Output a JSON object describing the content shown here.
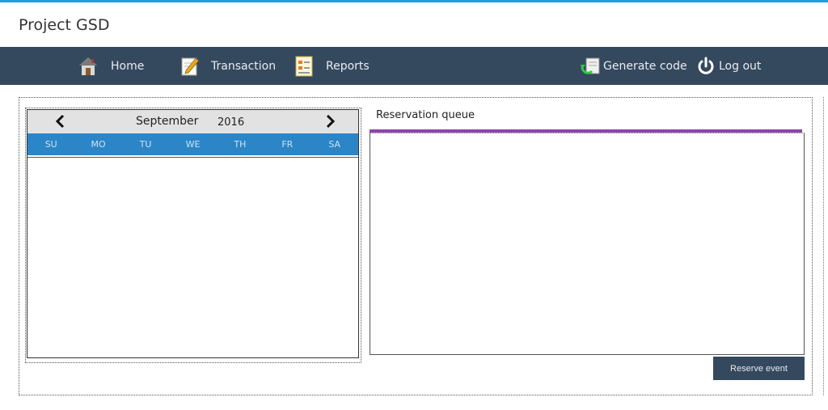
{
  "app": {
    "title": "Project GSD",
    "accent_color": "#1ba1e2"
  },
  "navbar": {
    "background": "#34495e",
    "items": [
      {
        "label": "Home",
        "icon": "house-icon"
      },
      {
        "label": "Transaction",
        "icon": "pencil-paper-icon"
      },
      {
        "label": "Reports",
        "icon": "report-document-icon"
      },
      {
        "label": "Generate code",
        "icon": "refresh-document-icon"
      },
      {
        "label": "Log out",
        "icon": "power-icon"
      }
    ]
  },
  "calendar": {
    "month": "September",
    "year": "2016",
    "prev_icon": "chevron-left-icon",
    "next_icon": "chevron-right-icon",
    "weekdays": [
      "SU",
      "MO",
      "TU",
      "WE",
      "TH",
      "FR",
      "SA"
    ],
    "weekday_bar_color": "#2b85c7"
  },
  "queue": {
    "title": "Reservation queue",
    "accent_color": "#8e44ad"
  },
  "actions": {
    "reserve_label": "Reserve event"
  }
}
